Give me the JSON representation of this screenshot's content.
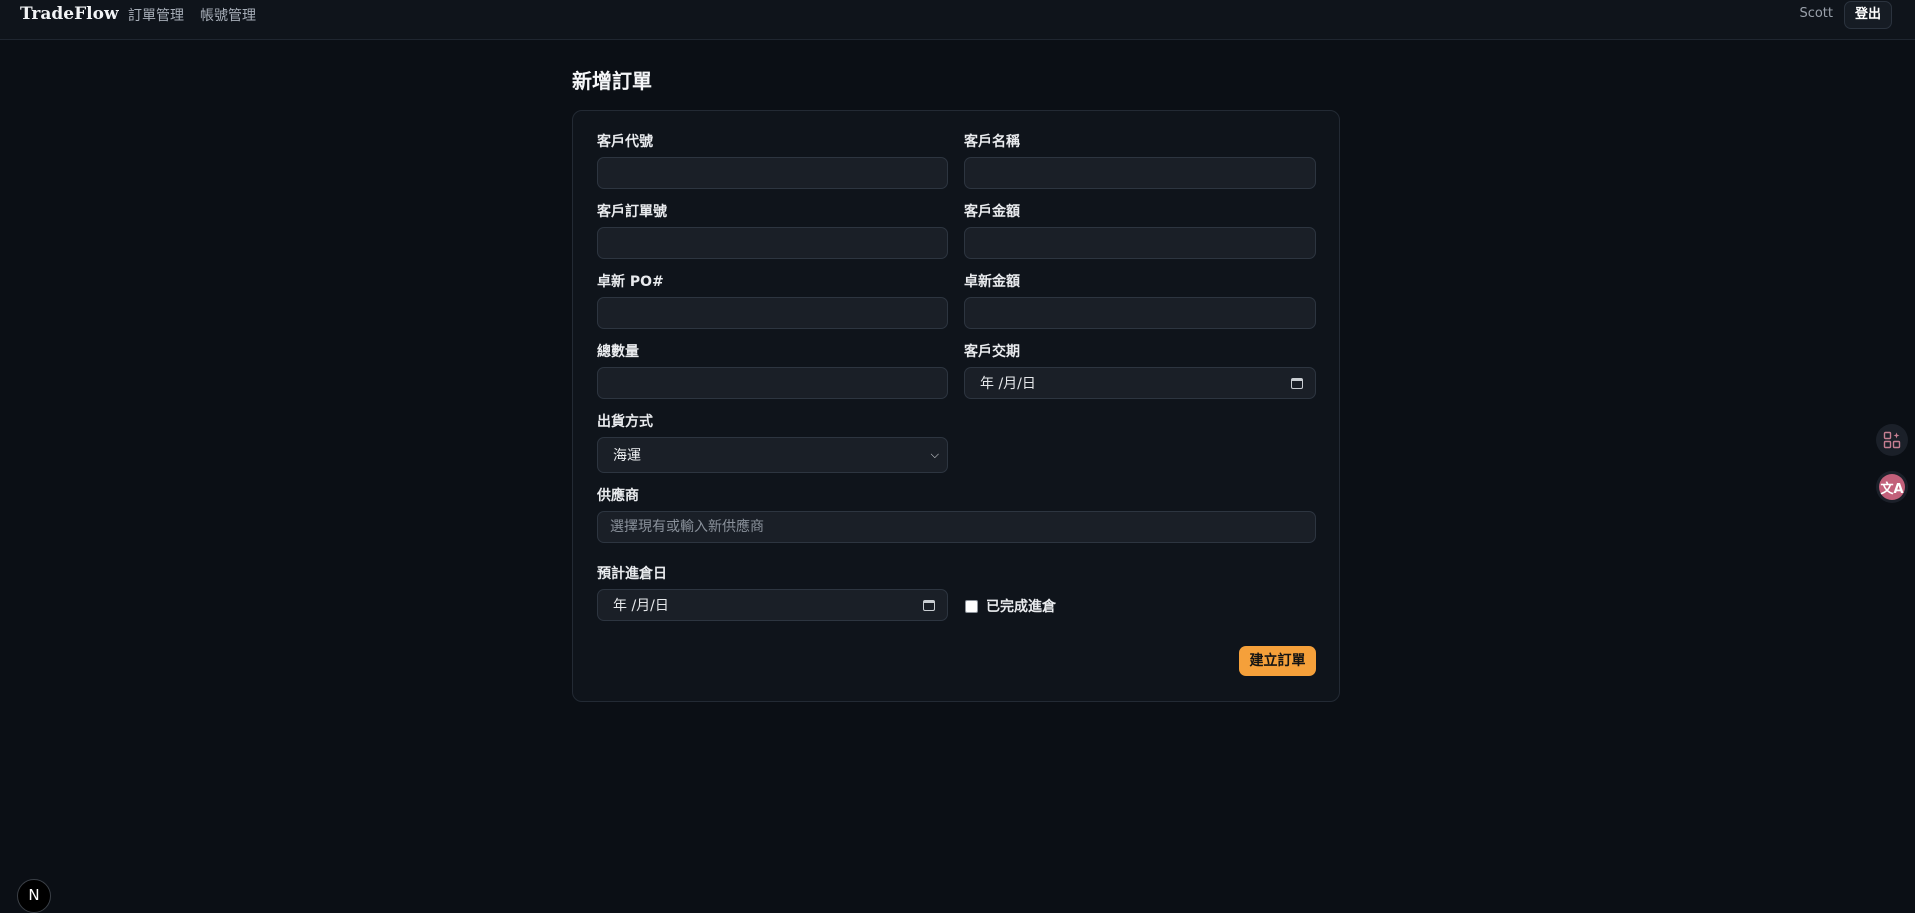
{
  "app": {
    "brand": "TradeFlow",
    "nav": [
      "訂單管理",
      "帳號管理"
    ],
    "user": "Scott",
    "logout_label": "登出"
  },
  "page": {
    "title": "新增訂單"
  },
  "form": {
    "customer_code_label": "客戶代號",
    "customer_code_value": "",
    "customer_name_label": "客戶名稱",
    "customer_name_value": "",
    "customer_order_no_label": "客戶訂單號",
    "customer_order_no_value": "",
    "customer_amount_label": "客戶金額",
    "customer_amount_value": "",
    "zhuoxin_po_label": "卓新 PO#",
    "zhuoxin_po_value": "",
    "zhuoxin_amount_label": "卓新金額",
    "zhuoxin_amount_value": "",
    "total_qty_label": "總數量",
    "total_qty_value": "",
    "customer_delivery_label": "客戶交期",
    "customer_delivery_display": "年 /月/日",
    "shipping_method_label": "出貨方式",
    "shipping_method_value": "海運",
    "supplier_label": "供應商",
    "supplier_placeholder": "選擇現有或輸入新供應商",
    "planned_inbound_label": "預計進倉日",
    "planned_inbound_display": "年 /月/日",
    "completed_inbound_label": "已完成進倉",
    "completed_inbound_checked": false,
    "submit_label": "建立訂單"
  },
  "side_tools": {
    "translate_glyph": "文A",
    "next_badge": "N"
  },
  "colors": {
    "background": "#0b0f15",
    "card": "#0f141b",
    "input": "#1a1f27",
    "accent": "#f5a03a"
  },
  "icons": [
    "apps-icon",
    "translate-icon",
    "calendar-icon",
    "chevron-down-icon",
    "nextjs-icon"
  ]
}
